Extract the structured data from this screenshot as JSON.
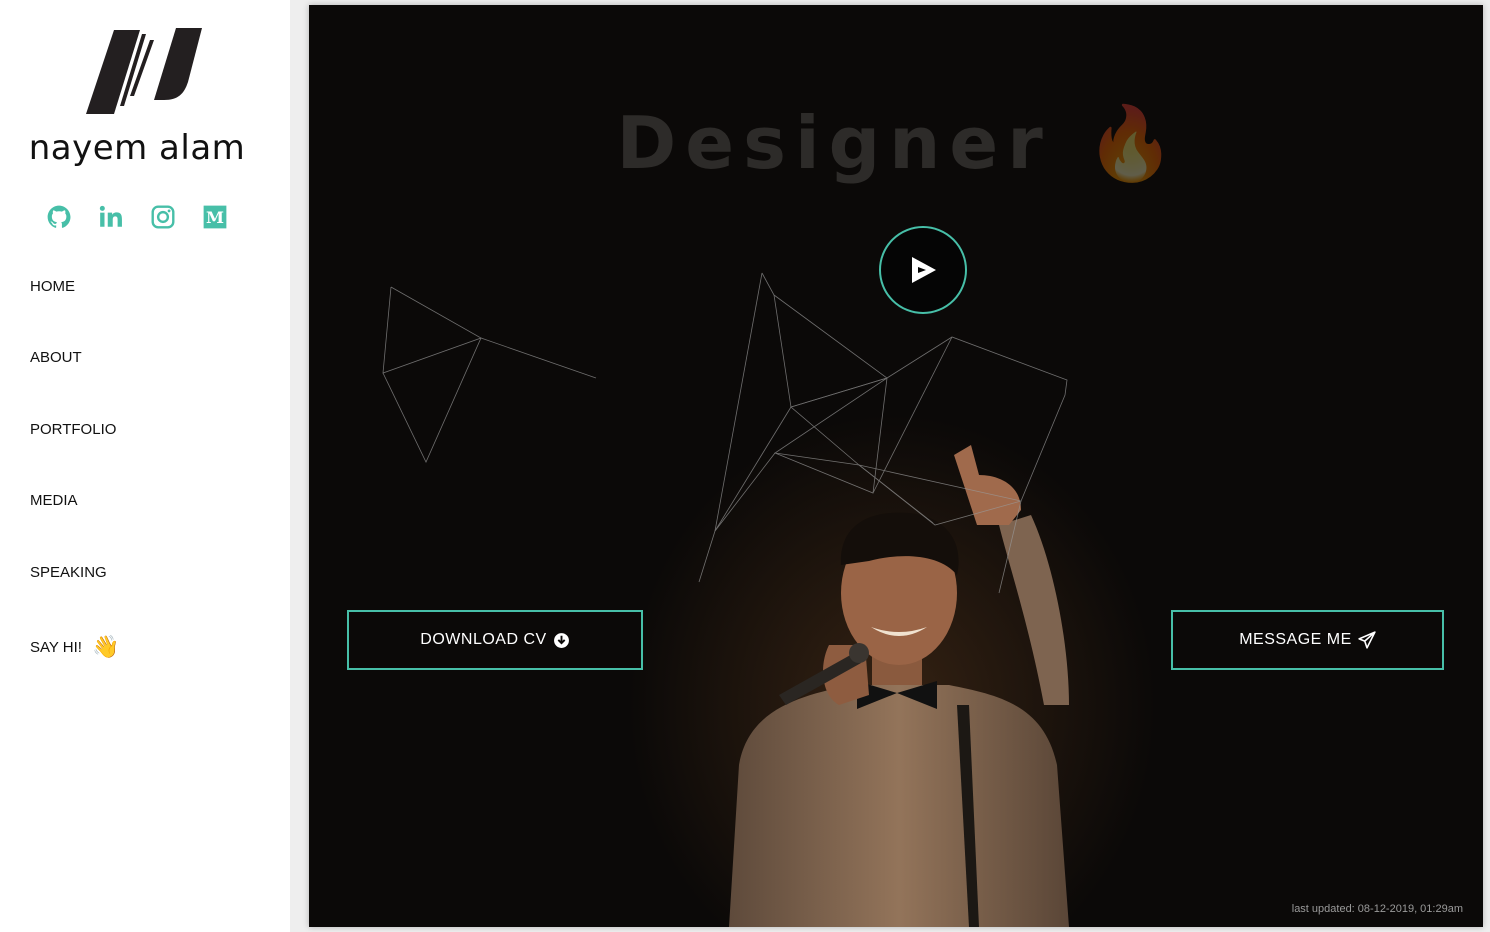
{
  "sidebar": {
    "brand_name": "nayem alam",
    "social": [
      {
        "icon": "github-icon"
      },
      {
        "icon": "linkedin-icon"
      },
      {
        "icon": "instagram-icon"
      },
      {
        "icon": "medium-icon"
      }
    ],
    "nav": [
      {
        "label": "HOME"
      },
      {
        "label": "ABOUT"
      },
      {
        "label": "PORTFOLIO"
      },
      {
        "label": "MEDIA"
      },
      {
        "label": "SPEAKING"
      },
      {
        "label": "SAY HI!",
        "emoji": "👋"
      }
    ]
  },
  "hero": {
    "headline": "Designer",
    "headline_emoji": "🔥",
    "play_icon": "play-icon",
    "download_label": "DOWNLOAD CV",
    "download_icon": "download-circle-icon",
    "message_label": "MESSAGE ME",
    "message_icon": "paper-plane-icon",
    "last_updated": "last updated: 08-12-2019, 01:29am"
  },
  "colors": {
    "accent": "#47bfa8",
    "hero_bg": "#0b0908",
    "text_dark": "#111111"
  }
}
